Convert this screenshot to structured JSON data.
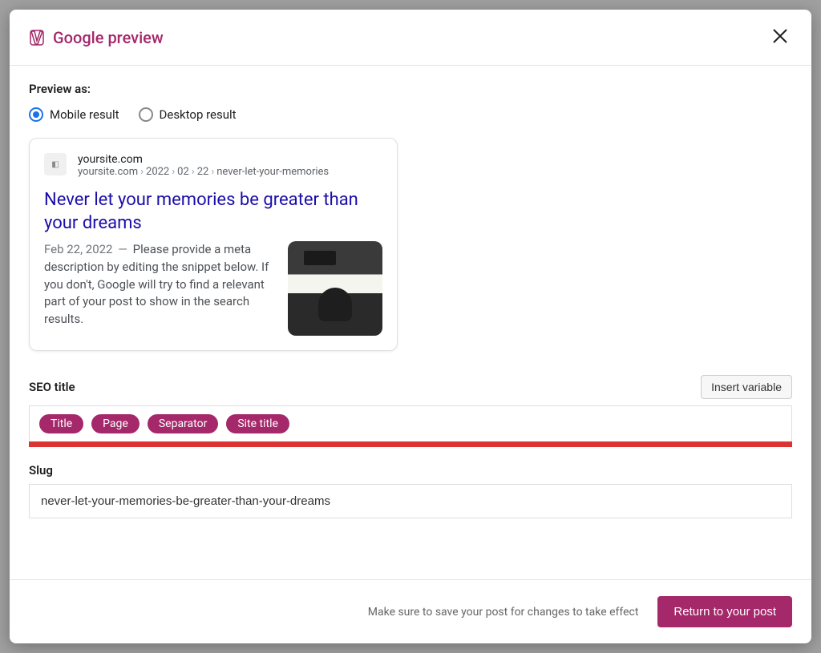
{
  "header": {
    "title": "Google preview"
  },
  "previewAs": {
    "label": "Preview as:",
    "options": {
      "mobile": "Mobile result",
      "desktop": "Desktop result"
    }
  },
  "snippet": {
    "siteName": "yoursite.com",
    "breadcrumb": {
      "domain": "yoursite.com",
      "year": "2022",
      "month": "02",
      "day": "22",
      "slug": "never-let-your-memories"
    },
    "title": "Never let your memories be greater than your dreams",
    "date": "Feb 22, 2022",
    "description": "Please provide a meta description by editing the snippet below. If you don't, Google will try to find a relevant part of your post to show in the search results."
  },
  "fields": {
    "seoTitle": {
      "label": "SEO title",
      "insertVariable": "Insert variable",
      "variables": [
        "Title",
        "Page",
        "Separator",
        "Site title"
      ]
    },
    "slug": {
      "label": "Slug",
      "value": "never-let-your-memories-be-greater-than-your-dreams"
    }
  },
  "footer": {
    "hint": "Make sure to save your post for changes to take effect",
    "returnButton": "Return to your post"
  }
}
